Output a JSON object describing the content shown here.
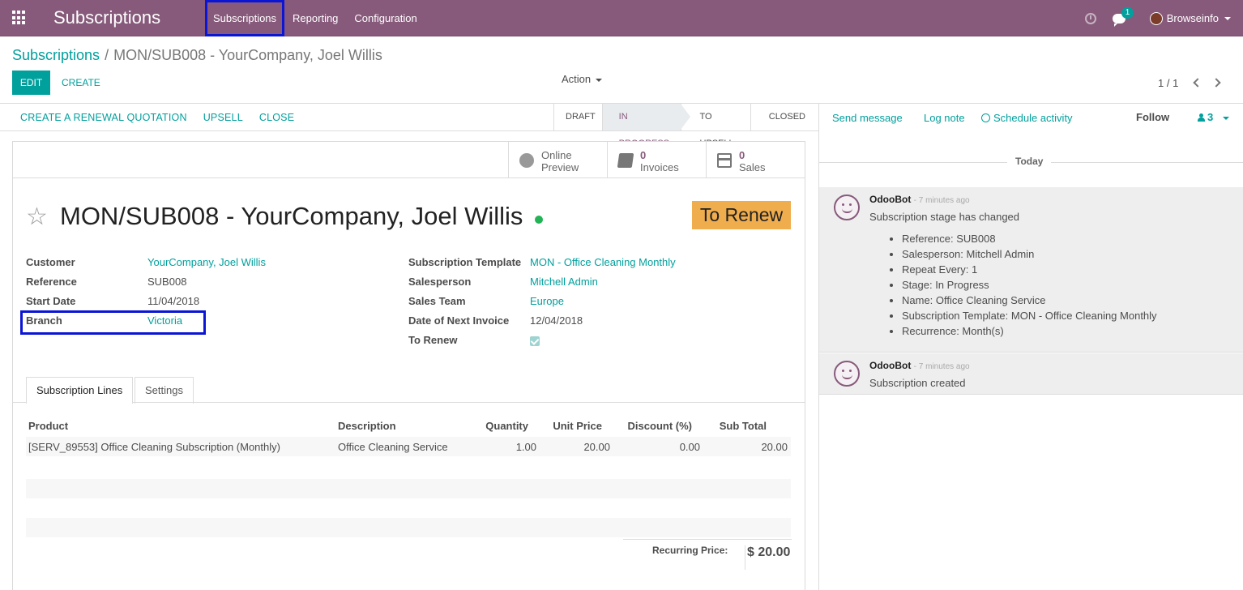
{
  "navbar": {
    "brand": "Subscriptions",
    "menu": [
      "Subscriptions",
      "Reporting",
      "Configuration"
    ],
    "active_menu": "Subscriptions",
    "chat_count": "1",
    "user": "Browseinfo",
    "bg_color": "#875a7b"
  },
  "breadcrumb": {
    "parent": "Subscriptions",
    "separator": "/",
    "current": "MON/SUB008 - YourCompany, Joel Willis"
  },
  "control": {
    "edit_label": "EDIT",
    "create_label": "CREATE",
    "action_label": "Action",
    "pager": "1 / 1"
  },
  "statusbar": {
    "buttons": [
      "CREATE A RENEWAL QUOTATION",
      "UPSELL",
      "CLOSE"
    ],
    "stages": [
      "DRAFT",
      "IN PROGRESS",
      "TO UPSELL",
      "CLOSED"
    ],
    "current_stage": "IN PROGRESS"
  },
  "smart_buttons": [
    {
      "icon": "globe-icon",
      "line1": "Online",
      "line2": "Preview"
    },
    {
      "icon": "book-icon",
      "value": "0",
      "label": "Invoices"
    },
    {
      "icon": "credit-card-icon",
      "value": "0",
      "label": "Sales"
    }
  ],
  "record": {
    "title": "MON/SUB008 - YourCompany, Joel Willis",
    "badge": "To Renew",
    "status_color": "#21b356",
    "left_fields": [
      {
        "label": "Customer",
        "value": "YourCompany, Joel Willis"
      },
      {
        "label": "Reference",
        "value": "SUB008"
      },
      {
        "label": "Start Date",
        "value": "11/04/2018"
      },
      {
        "label": "Branch",
        "value": "Victoria"
      }
    ],
    "right_fields": [
      {
        "label": "Subscription Template",
        "value": "MON - Office Cleaning Monthly"
      },
      {
        "label": "Salesperson",
        "value": "Mitchell Admin"
      },
      {
        "label": "Sales Team",
        "value": "Europe"
      },
      {
        "label": "Date of Next Invoice",
        "value": "12/04/2018"
      },
      {
        "label": "To Renew",
        "value": true
      }
    ]
  },
  "tabs": [
    "Subscription Lines",
    "Settings"
  ],
  "lines": {
    "headers": [
      "Product",
      "Description",
      "Quantity",
      "Unit Price",
      "Discount (%)",
      "Sub Total"
    ],
    "rows": [
      [
        "[SERV_89553] Office Cleaning Subscription (Monthly)",
        "Office Cleaning Service",
        "1.00",
        "20.00",
        "0.00",
        "20.00"
      ]
    ],
    "total_label": "Recurring Price:",
    "total_value": "$ 20.00"
  },
  "chatter": {
    "send_message": "Send message",
    "log_note": "Log note",
    "schedule_activity": "Schedule activity",
    "follow": "Follow",
    "followers": "3",
    "date_separator": "Today",
    "messages": [
      {
        "author": "OdooBot",
        "time": "- 7 minutes ago",
        "body": "Subscription stage has changed",
        "items": [
          "Reference: SUB008",
          "Salesperson: Mitchell Admin",
          "Repeat Every: 1",
          "Stage: In Progress",
          "Name: Office Cleaning Service",
          "Subscription Template: MON - Office Cleaning Monthly",
          "Recurrence: Month(s)"
        ]
      },
      {
        "author": "OdooBot",
        "time": "- 7 minutes ago",
        "body": "Subscription created",
        "items": []
      }
    ]
  }
}
